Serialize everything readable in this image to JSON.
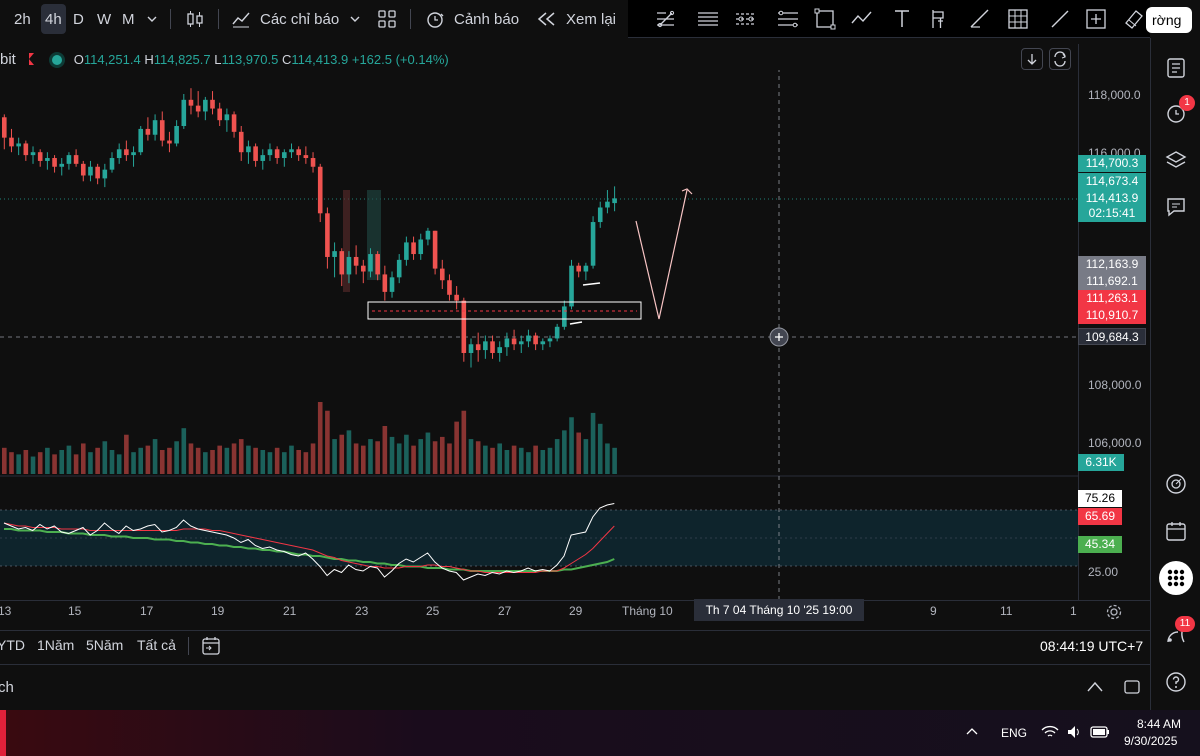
{
  "toolbar": {
    "timeframes": [
      "2h",
      "4h",
      "D",
      "W",
      "M"
    ],
    "active_timeframe": "4h",
    "indicators_label": "Các chỉ báo",
    "alerts_label": "Cảnh báo",
    "replay_label": "Xem lại",
    "right_button_label": "rờng"
  },
  "legend": {
    "exchange": "bit",
    "open_label": "O",
    "open": "114,251.4",
    "high_label": "H",
    "high": "114,825.7",
    "low_label": "L",
    "low": "113,970.5",
    "close_label": "C",
    "close": "114,413.9",
    "change": "+162.5 (+0.14%)"
  },
  "price_scale": {
    "ticks": [
      "118,000.0",
      "116,000.0",
      "108,000.0",
      "106,000.0"
    ],
    "labels": [
      {
        "value": "114,700.3",
        "color": "#26a69a"
      },
      {
        "value": "114,673.4",
        "color": "#26a69a"
      },
      {
        "value": "114,413.9",
        "color": "#26a69a"
      },
      {
        "value": "02:15:41",
        "color": "#26a69a"
      },
      {
        "value": "112,163.9",
        "color": "#787b86"
      },
      {
        "value": "111,692.1",
        "color": "#787b86"
      },
      {
        "value": "111,263.1",
        "color": "#f23645"
      },
      {
        "value": "110,910.7",
        "color": "#f23645"
      },
      {
        "value": "109,684.3",
        "color": "#2a2e39"
      }
    ],
    "volume_label": "6.31K",
    "rsi_labels": [
      {
        "value": "75.26",
        "color": "#ffffff"
      },
      {
        "value": "65.69",
        "color": "#f23645"
      },
      {
        "value": "45.34",
        "color": "#4caf50"
      }
    ],
    "rsi_tick": "25.00"
  },
  "date_axis": {
    "ticks": [
      "13",
      "15",
      "17",
      "19",
      "21",
      "23",
      "25",
      "27",
      "29",
      "Tháng 10",
      "9",
      "11",
      "1"
    ],
    "crosshair_label": "Th 7 04 Tháng 10 '25   19:00"
  },
  "bottom_bar": {
    "ranges": [
      "YTD",
      "1Năm",
      "5Năm",
      "Tất cả"
    ],
    "clock": "08:44:19 UTC+7"
  },
  "panel": {
    "label": "ch"
  },
  "sidebar": {
    "alert_badge": "1",
    "notif_badge": "11"
  },
  "taskbar": {
    "lang": "ENG",
    "time": "8:44 AM",
    "date": "9/30/2025"
  },
  "colors": {
    "up": "#26a69a",
    "down": "#ef5350",
    "background": "#0f0f0f"
  },
  "chart_data": {
    "type": "candlestick",
    "x_label": "",
    "y_label": "",
    "ylim": [
      105000,
      118800
    ],
    "candles": [
      [
        117200,
        117300,
        116100,
        116500
      ],
      [
        116500,
        116800,
        116000,
        116200
      ],
      [
        116200,
        116500,
        115900,
        116300
      ],
      [
        116300,
        116400,
        115700,
        115900
      ],
      [
        115900,
        116200,
        115600,
        116000
      ],
      [
        116000,
        116100,
        115500,
        115700
      ],
      [
        115700,
        116000,
        115400,
        115800
      ],
      [
        115800,
        115900,
        115300,
        115500
      ],
      [
        115500,
        115800,
        115200,
        115600
      ],
      [
        115600,
        116000,
        115400,
        115900
      ],
      [
        115900,
        116100,
        115500,
        115600
      ],
      [
        115600,
        115700,
        115000,
        115200
      ],
      [
        115200,
        115700,
        115000,
        115500
      ],
      [
        115500,
        115600,
        114900,
        115100
      ],
      [
        115100,
        115600,
        114800,
        115400
      ],
      [
        115400,
        116000,
        115300,
        115800
      ],
      [
        115800,
        116300,
        115600,
        116100
      ],
      [
        116100,
        116400,
        115700,
        115900
      ],
      [
        115900,
        116200,
        115500,
        116000
      ],
      [
        116000,
        116900,
        115900,
        116800
      ],
      [
        116800,
        117200,
        116400,
        116600
      ],
      [
        116600,
        117300,
        116400,
        117100
      ],
      [
        117100,
        117400,
        116200,
        116400
      ],
      [
        116400,
        116700,
        116000,
        116300
      ],
      [
        116300,
        117100,
        116200,
        116900
      ],
      [
        116900,
        118000,
        116800,
        117800
      ],
      [
        117800,
        118200,
        117300,
        117600
      ],
      [
        117600,
        118100,
        117200,
        117400
      ],
      [
        117400,
        117900,
        117100,
        117800
      ],
      [
        117800,
        118100,
        117300,
        117500
      ],
      [
        117500,
        117700,
        116900,
        117100
      ],
      [
        117100,
        117500,
        116700,
        117300
      ],
      [
        117300,
        117400,
        116500,
        116700
      ],
      [
        116700,
        116900,
        115700,
        116000
      ],
      [
        116000,
        116400,
        115600,
        116200
      ],
      [
        116200,
        116300,
        115500,
        115700
      ],
      [
        115700,
        116100,
        115400,
        115900
      ],
      [
        115900,
        116300,
        115700,
        116100
      ],
      [
        116100,
        116200,
        115600,
        115800
      ],
      [
        115800,
        116100,
        115500,
        116000
      ],
      [
        116000,
        116300,
        115800,
        116100
      ],
      [
        116100,
        116200,
        115700,
        115900
      ],
      [
        115900,
        116200,
        115600,
        115800
      ],
      [
        115800,
        116000,
        115300,
        115500
      ],
      [
        115500,
        115600,
        113600,
        113900
      ],
      [
        113900,
        114100,
        112000,
        112400
      ],
      [
        112400,
        112900,
        111700,
        112600
      ],
      [
        112600,
        112700,
        111400,
        111800
      ],
      [
        111800,
        112600,
        111500,
        112400
      ],
      [
        112400,
        112800,
        111800,
        112100
      ],
      [
        112100,
        112300,
        111500,
        111900
      ],
      [
        111900,
        112700,
        111700,
        112500
      ],
      [
        112500,
        112600,
        111600,
        111800
      ],
      [
        111800,
        112100,
        110900,
        111200
      ],
      [
        111200,
        111900,
        111000,
        111700
      ],
      [
        111700,
        112500,
        111500,
        112300
      ],
      [
        112300,
        113100,
        112100,
        112900
      ],
      [
        112900,
        113100,
        112300,
        112500
      ],
      [
        112500,
        113200,
        112300,
        113000
      ],
      [
        113000,
        113400,
        112800,
        113300
      ],
      [
        113300,
        113300,
        111800,
        112000
      ],
      [
        112000,
        112300,
        111300,
        111600
      ],
      [
        111600,
        111800,
        110900,
        111100
      ],
      [
        111100,
        111400,
        110600,
        110900
      ],
      [
        110900,
        111000,
        108800,
        109100
      ],
      [
        109100,
        109600,
        108600,
        109400
      ],
      [
        109400,
        109800,
        108800,
        109200
      ],
      [
        109200,
        109700,
        108900,
        109500
      ],
      [
        109500,
        109700,
        108900,
        109100
      ],
      [
        109100,
        109500,
        108800,
        109300
      ],
      [
        109300,
        109800,
        109000,
        109600
      ],
      [
        109600,
        109900,
        109200,
        109400
      ],
      [
        109400,
        109700,
        109100,
        109500
      ],
      [
        109500,
        109900,
        109300,
        109700
      ],
      [
        109700,
        109800,
        109200,
        109400
      ],
      [
        109400,
        109600,
        109200,
        109500
      ],
      [
        109500,
        109700,
        109300,
        109600
      ],
      [
        109600,
        110100,
        109500,
        110000
      ],
      [
        110000,
        110900,
        109900,
        110700
      ],
      [
        110700,
        112300,
        110600,
        112100
      ],
      [
        112100,
        112200,
        111700,
        111900
      ],
      [
        111900,
        112200,
        111600,
        112100
      ],
      [
        112100,
        113800,
        112000,
        113600
      ],
      [
        113600,
        114300,
        113400,
        114100
      ],
      [
        114100,
        114700,
        113900,
        114300
      ],
      [
        114251,
        114826,
        113971,
        114414
      ]
    ],
    "volume": [
      1.2,
      1.0,
      0.9,
      1.1,
      0.8,
      1.0,
      1.2,
      0.9,
      1.1,
      1.3,
      0.9,
      1.4,
      1.0,
      1.2,
      1.5,
      1.1,
      0.9,
      1.8,
      1.0,
      1.2,
      1.3,
      1.6,
      1.1,
      1.2,
      1.5,
      2.1,
      1.4,
      1.2,
      1.0,
      1.1,
      1.3,
      1.2,
      1.4,
      1.6,
      1.3,
      1.2,
      1.1,
      1.0,
      1.2,
      1.0,
      1.3,
      1.1,
      1.0,
      1.4,
      3.3,
      2.9,
      1.6,
      1.8,
      2.0,
      1.4,
      1.3,
      1.6,
      1.5,
      2.2,
      1.7,
      1.4,
      1.8,
      1.3,
      1.6,
      1.9,
      1.5,
      1.7,
      1.4,
      2.4,
      2.9,
      1.6,
      1.5,
      1.3,
      1.2,
      1.4,
      1.1,
      1.3,
      1.2,
      1.0,
      1.3,
      1.1,
      1.2,
      1.6,
      2.0,
      2.6,
      1.9,
      1.6,
      2.8,
      2.3,
      1.4,
      1.2
    ],
    "volume_unit": "K",
    "rsi": {
      "ylim": [
        20,
        80
      ],
      "band": [
        30,
        70
      ],
      "rsi": [
        62,
        60,
        58,
        59,
        57,
        61,
        58,
        60,
        56,
        55,
        57,
        59,
        54,
        57,
        62,
        58,
        55,
        60,
        57,
        58,
        60,
        61,
        56,
        57,
        59,
        64,
        60,
        58,
        57,
        56,
        55,
        54,
        52,
        49,
        51,
        47,
        45,
        46,
        44,
        43,
        41,
        40,
        42,
        38,
        33,
        27,
        31,
        29,
        34,
        31,
        30,
        33,
        32,
        26,
        30,
        35,
        38,
        36,
        39,
        42,
        36,
        32,
        30,
        29,
        24,
        26,
        28,
        27,
        29,
        28,
        30,
        29,
        30,
        32,
        30,
        31,
        30,
        34,
        40,
        54,
        55,
        56,
        66,
        72,
        74,
        75
      ],
      "ma": [
        62,
        61,
        60,
        60,
        59,
        59,
        59,
        59,
        58,
        58,
        58,
        58,
        57,
        57,
        57,
        57,
        57,
        57,
        57,
        57,
        57,
        57,
        57,
        57,
        57,
        58,
        58,
        58,
        58,
        57,
        57,
        56,
        55,
        54,
        53,
        52,
        51,
        50,
        49,
        48,
        47,
        46,
        45,
        44,
        42,
        40,
        39,
        37,
        36,
        35,
        34,
        33,
        33,
        32,
        32,
        32,
        33,
        33,
        33,
        34,
        34,
        33,
        33,
        32,
        31,
        30,
        30,
        29,
        29,
        29,
        29,
        29,
        29,
        29,
        29,
        30,
        30,
        30,
        32,
        35,
        38,
        41,
        45,
        50,
        55,
        60
      ],
      "smooth": [
        58,
        58,
        57,
        57,
        57,
        57,
        56,
        56,
        56,
        55,
        55,
        55,
        54,
        54,
        54,
        53,
        53,
        53,
        52,
        52,
        52,
        51,
        51,
        51,
        50,
        50,
        49,
        49,
        48,
        48,
        47,
        47,
        46,
        46,
        45,
        45,
        44,
        44,
        43,
        43,
        42,
        41,
        41,
        40,
        40,
        39,
        38,
        38,
        37,
        37,
        36,
        36,
        35,
        35,
        34,
        34,
        33,
        33,
        33,
        32,
        32,
        32,
        31,
        31,
        31,
        30,
        30,
        30,
        30,
        30,
        30,
        30,
        30,
        30,
        30,
        30,
        30,
        30,
        31,
        31,
        32,
        33,
        34,
        35,
        36,
        38
      ],
      "values_shown": {
        "rsi": 75.26,
        "ma": 65.69,
        "smooth": 45.34
      }
    }
  }
}
